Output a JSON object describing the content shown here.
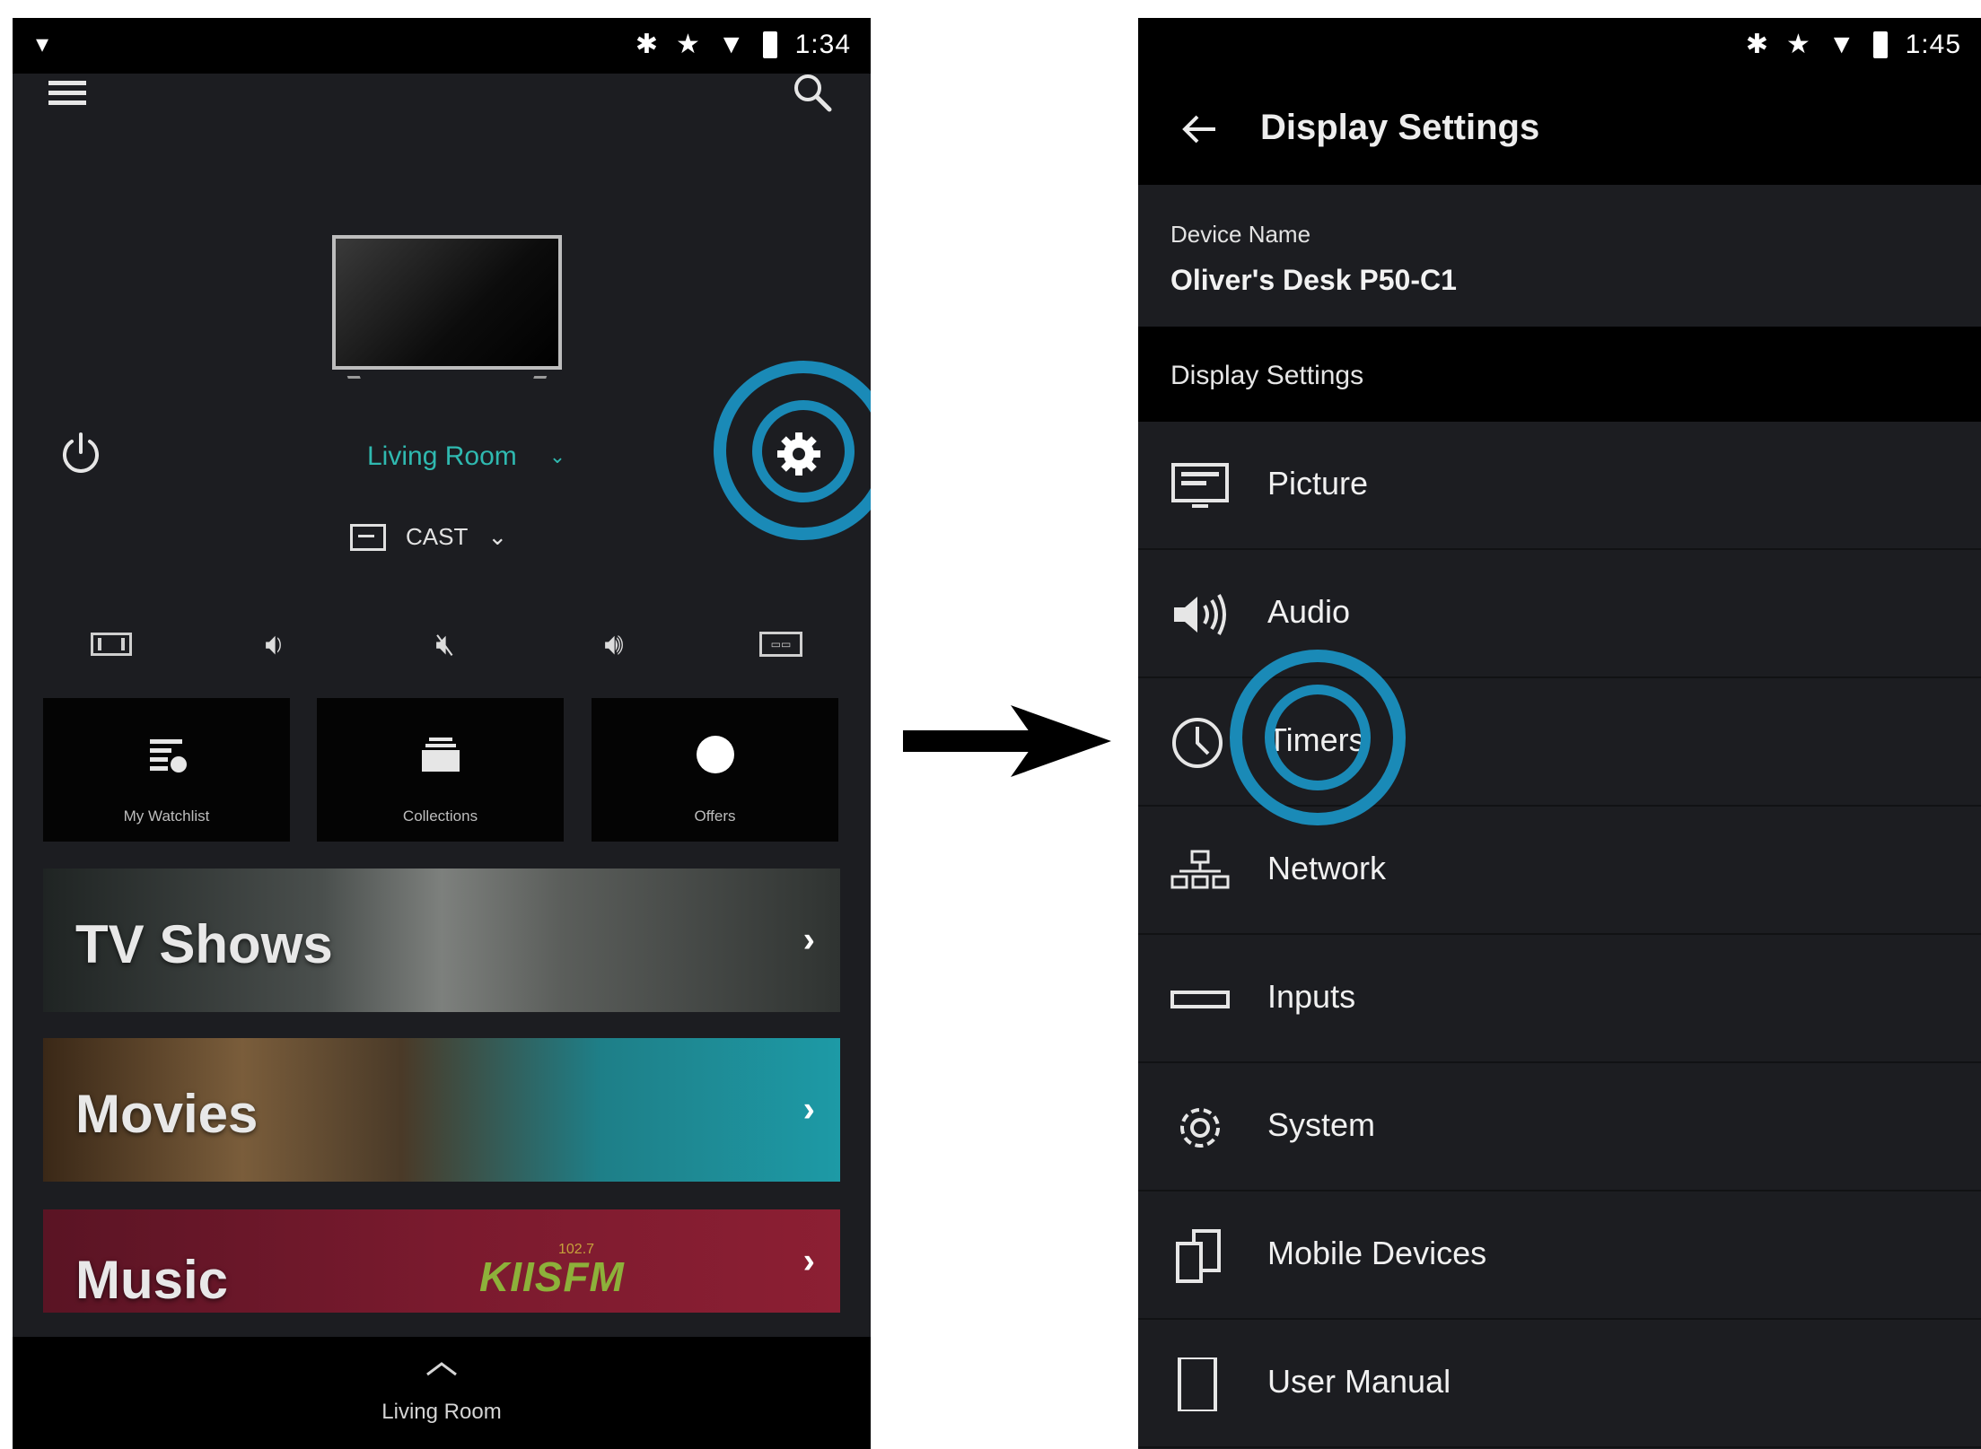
{
  "left": {
    "statusbar": {
      "time": "1:34"
    },
    "room": {
      "label": "Living Room"
    },
    "cast": {
      "label": "CAST"
    },
    "tiles": [
      {
        "label": "My Watchlist"
      },
      {
        "label": "Collections"
      },
      {
        "label": "Offers"
      }
    ],
    "banners": [
      {
        "title": "TV Shows"
      },
      {
        "title": "Movies"
      },
      {
        "title": "Music"
      }
    ],
    "music_logo": {
      "text": "KIISFM",
      "freq": "102.7"
    },
    "bottom_bar": {
      "label": "Living Room"
    }
  },
  "right": {
    "statusbar": {
      "time": "1:45"
    },
    "header": {
      "title": "Display Settings"
    },
    "device": {
      "label": "Device Name",
      "value": "Oliver's Desk P50-C1"
    },
    "section": {
      "label": "Display Settings"
    },
    "items": [
      {
        "label": "Picture",
        "icon": "picture-icon"
      },
      {
        "label": "Audio",
        "icon": "audio-icon"
      },
      {
        "label": "Timers",
        "icon": "clock-icon"
      },
      {
        "label": "Network",
        "icon": "network-icon"
      },
      {
        "label": "Inputs",
        "icon": "inputs-icon"
      },
      {
        "label": "System",
        "icon": "gear-icon"
      },
      {
        "label": "Mobile Devices",
        "icon": "mobile-devices-icon"
      },
      {
        "label": "User Manual",
        "icon": "manual-icon"
      }
    ]
  },
  "colors": {
    "highlight_ring": "#1a8ab7",
    "accent_teal": "#2fb9b0",
    "app_background": "#1c1d21"
  }
}
